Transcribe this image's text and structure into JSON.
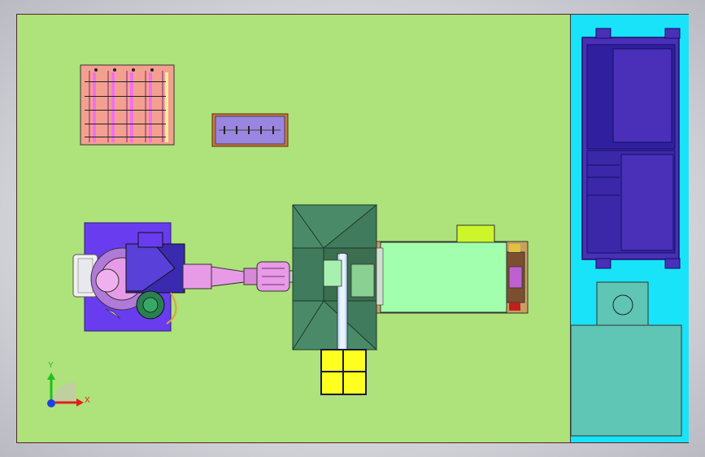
{
  "triad": {
    "x_label": "X",
    "y_label": "Y"
  },
  "colors": {
    "floor": "#aee27a",
    "side_panel": "#19e3f8",
    "cabinet": "#4a2fb8",
    "cabinet_dark": "#2a1880",
    "robot_base": "#6a3cf0",
    "robot_arm": "#e79be6",
    "machine_body": "#a2ffad",
    "hopper": "#3f7b5c",
    "yellow_box": "#ffff20",
    "fixture_pink": "#f3a090",
    "fixture_purple": "#9a86e0",
    "teal_box": "#5fc5b4",
    "axis_x": "#e02020",
    "axis_y": "#20c020",
    "axis_z": "#2040e0"
  }
}
